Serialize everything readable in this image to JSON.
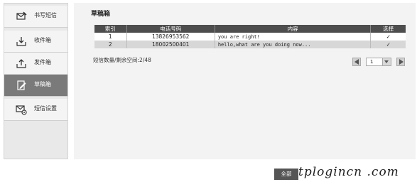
{
  "sidebar": {
    "items": [
      {
        "label": "书写短信",
        "icon": "compose-icon",
        "active": false
      },
      {
        "label": "收件箱",
        "icon": "inbox-icon",
        "active": false
      },
      {
        "label": "发件箱",
        "icon": "outbox-icon",
        "active": false
      },
      {
        "label": "草稿箱",
        "icon": "drafts-icon",
        "active": true
      },
      {
        "label": "短信设置",
        "icon": "sms-settings-icon",
        "active": false
      }
    ]
  },
  "main": {
    "title": "草稿箱",
    "table": {
      "headers": [
        "索引",
        "电话号码",
        "内容",
        "选择"
      ],
      "rows": [
        {
          "index": "1",
          "phone": "13826953562",
          "content": "you are right!",
          "select": "✓"
        },
        {
          "index": "2",
          "phone": "18002500401",
          "content": "hello,what are you doing now...",
          "select": "✓"
        }
      ]
    },
    "stats": "短信数量/剩余空间:2/48",
    "pager": {
      "page": "1"
    }
  },
  "footer": {
    "delete_button": "全部",
    "watermark": "tplogincn .com"
  },
  "colors": {
    "header_bg": "#4d4d4d",
    "active_item_bg": "#7a7a7a",
    "row_alt_bg": "#d7d7d7"
  }
}
